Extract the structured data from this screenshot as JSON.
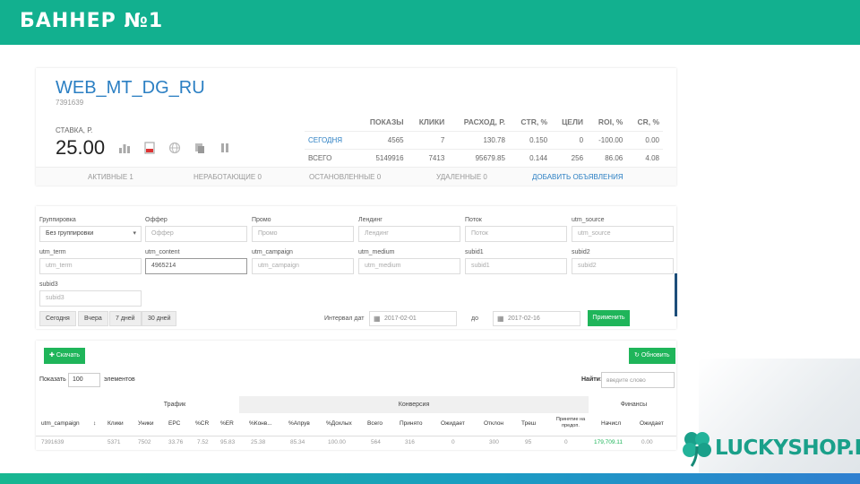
{
  "slide": {
    "title": "БАННЕР №1"
  },
  "campaign": {
    "title": "WEB_MT_DG_RU",
    "id": "7391639",
    "rate_label": "СТАВКА, Р.",
    "rate_value": "25.00"
  },
  "toolbar_icons": [
    "bar-chart-icon",
    "pdf-icon",
    "globe-icon",
    "copy-icon",
    "pause-icon"
  ],
  "stats": {
    "headers": [
      "",
      "ПОКАЗЫ",
      "КЛИКИ",
      "РАСХОД, Р.",
      "CTR, %",
      "ЦЕЛИ",
      "ROI, %",
      "CR, %"
    ],
    "rows": [
      [
        "СЕГОДНЯ",
        "4565",
        "7",
        "130.78",
        "0.150",
        "0",
        "-100.00",
        "0.00"
      ],
      [
        "ВСЕГО",
        "5149916",
        "7413",
        "95679.85",
        "0.144",
        "256",
        "86.06",
        "4.08"
      ]
    ]
  },
  "tabs": [
    "АКТИВНЫЕ 1",
    "НЕРАБОТАЮЩИЕ 0",
    "ОСТАНОВЛЕННЫЕ 0",
    "УДАЛЕННЫЕ 0",
    "ДОБАВИТЬ ОБЪЯВЛЕНИЯ"
  ],
  "filters": {
    "grouping": {
      "label": "Группировка",
      "value": "Без группировки"
    },
    "offer": {
      "label": "Оффер",
      "placeholder": "Оффер"
    },
    "promo": {
      "label": "Промо",
      "placeholder": "Промо"
    },
    "landing": {
      "label": "Лендинг",
      "placeholder": "Лендинг"
    },
    "flow": {
      "label": "Поток",
      "placeholder": "Поток"
    },
    "utm_source": {
      "label": "utm_source",
      "placeholder": "utm_source"
    },
    "utm_term": {
      "label": "utm_term",
      "placeholder": "utm_term"
    },
    "utm_content": {
      "label": "utm_content",
      "value": "4965214"
    },
    "utm_campaign": {
      "label": "utm_campaign",
      "placeholder": "utm_campaign"
    },
    "utm_medium": {
      "label": "utm_medium",
      "placeholder": "utm_medium"
    },
    "subid1": {
      "label": "subid1",
      "placeholder": "subid1"
    },
    "subid2": {
      "label": "subid2",
      "placeholder": "subid2"
    },
    "subid3": {
      "label": "subid3",
      "placeholder": "subid3"
    }
  },
  "period_buttons": [
    "Сегодня",
    "Вчера",
    "7 дней",
    "30 дней"
  ],
  "date_range": {
    "label": "Интервал дат",
    "from": "2017-02-01",
    "to_label": "до",
    "to": "2017-02-16",
    "apply": "Применить"
  },
  "table_controls": {
    "download": "Скачать",
    "refresh": "Обновить",
    "show_label": "Показать",
    "show_value": "100",
    "show_suffix": "элементов",
    "find_label": "Найти:",
    "find_placeholder": "введите слово"
  },
  "table": {
    "groups": [
      "Трафик",
      "Конверсия",
      "Финансы"
    ],
    "columns": [
      "utm_campaign",
      "Клики",
      "Уники",
      "EPC",
      "%CR",
      "%ER",
      "%Конв...",
      "%Апрув",
      "%Дохлых",
      "Всего",
      "Принято",
      "Ожидает",
      "Отклон",
      "Треш",
      "Принятие на предоп.",
      "Начисл",
      "Ожидает"
    ],
    "row": [
      "7391639",
      "5371",
      "7502",
      "33.76",
      "7.52",
      "95.83",
      "25.38",
      "85.34",
      "100.00",
      "564",
      "316",
      "0",
      "300",
      "95",
      "0",
      "179,709.11",
      "0.00"
    ]
  },
  "logo": {
    "text": "LUCKYSHOP.RU"
  },
  "colors": {
    "brand_green": "#12b08f",
    "button_green": "#1fb55a",
    "link_blue": "#2b7fc3"
  }
}
